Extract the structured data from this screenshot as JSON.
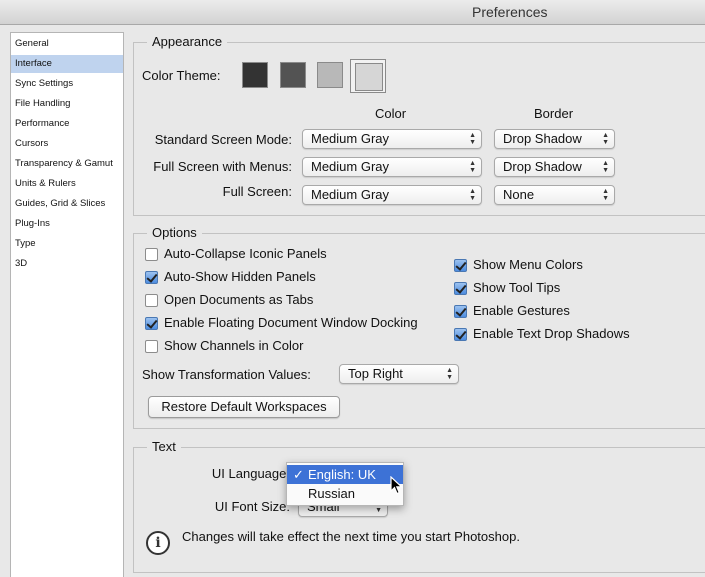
{
  "window": {
    "title": "Preferences"
  },
  "sidebar": {
    "items": [
      {
        "label": "General"
      },
      {
        "label": "Interface",
        "selected": true
      },
      {
        "label": "Sync Settings"
      },
      {
        "label": "File Handling"
      },
      {
        "label": "Performance"
      },
      {
        "label": "Cursors"
      },
      {
        "label": "Transparency & Gamut"
      },
      {
        "label": "Units & Rulers"
      },
      {
        "label": "Guides, Grid & Slices"
      },
      {
        "label": "Plug-Ins"
      },
      {
        "label": "Type"
      },
      {
        "label": "3D"
      }
    ]
  },
  "appearance": {
    "title": "Appearance",
    "color_theme_label": "Color Theme:",
    "themes": [
      {
        "name": "darkest",
        "color": "#333333"
      },
      {
        "name": "dark",
        "color": "#535353"
      },
      {
        "name": "light",
        "color": "#b8b8b8"
      },
      {
        "name": "lightest",
        "color": "#d6d6d6",
        "selected": true
      }
    ],
    "col_color": "Color",
    "col_border": "Border",
    "rows": [
      {
        "label": "Standard Screen Mode:",
        "color": "Medium Gray",
        "border": "Drop Shadow"
      },
      {
        "label": "Full Screen with Menus:",
        "color": "Medium Gray",
        "border": "Drop Shadow"
      },
      {
        "label": "Full Screen:",
        "color": "Medium Gray",
        "border": "None"
      }
    ]
  },
  "options": {
    "title": "Options",
    "left_checks": [
      {
        "label": "Auto-Collapse Iconic Panels",
        "checked": false
      },
      {
        "label": "Auto-Show Hidden Panels",
        "checked": true
      },
      {
        "label": "Open Documents as Tabs",
        "checked": false
      },
      {
        "label": "Enable Floating Document Window Docking",
        "checked": true
      },
      {
        "label": "Show Channels in Color",
        "checked": false
      }
    ],
    "right_checks": [
      {
        "label": "Show Menu Colors",
        "checked": true
      },
      {
        "label": "Show Tool Tips",
        "checked": true
      },
      {
        "label": "Enable Gestures",
        "checked": true
      },
      {
        "label": "Enable Text Drop Shadows",
        "checked": true
      }
    ],
    "transform_label": "Show Transformation Values:",
    "transform_value": "Top Right",
    "restore_button": "Restore Default Workspaces"
  },
  "text": {
    "title": "Text",
    "ui_language_label": "UI Language:",
    "language_menu": [
      {
        "label": "English: UK",
        "checked": true,
        "check_mark": "✓"
      },
      {
        "label": "Russian",
        "checked": false
      }
    ],
    "ui_font_size_label": "UI Font Size:",
    "ui_font_size_value": "Small",
    "info_icon": "info-icon",
    "info_glyph": "i",
    "notice": "Changes will take effect the next time you start Photoshop."
  },
  "colors": {
    "selection": "#bfd3ee",
    "menu_highlight": "#3d72d6",
    "checkbox_blue": "#4d8de0"
  }
}
